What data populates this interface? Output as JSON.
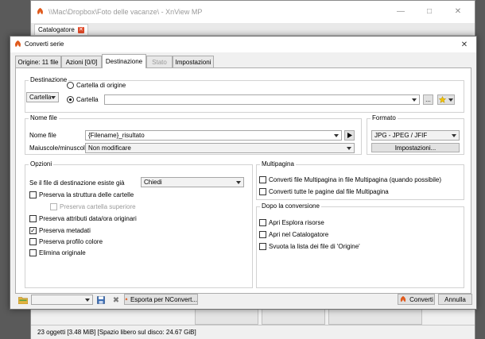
{
  "background_window": {
    "title": "\\\\Mac\\Dropbox\\Foto delle vacanze\\ - XnView MP",
    "tab_label": "Catalogatore",
    "status_text": "23 oggetti [3.48 MiB] [Spazio libero sul disco: 24.67 GiB]"
  },
  "dialog": {
    "title": "Converti serie",
    "tabs": [
      {
        "label": "Origine: 11 file"
      },
      {
        "label": "Azioni [0/0]"
      },
      {
        "label": "Destinazione"
      },
      {
        "label": "Stato"
      },
      {
        "label": "Impostazioni"
      }
    ],
    "destinazione": {
      "group_label": "Destinazione",
      "mode_select_value": "Cartella",
      "radio_origin_label": "Cartella di origine",
      "radio_folder_label": "Cartella",
      "folder_path_value": "",
      "browse_label": "..."
    },
    "nome_file": {
      "group_label": "Nome file",
      "name_label": "Nome file",
      "name_value": "{Filename}_risultato",
      "case_label": "Maiuscole/minuscole",
      "case_value": "Non modificare"
    },
    "formato": {
      "group_label": "Formato",
      "format_value": "JPG - JPEG / JFIF",
      "settings_button": "Impostazioni..."
    },
    "opzioni": {
      "group_label": "Opzioni",
      "exists_label": "Se il file di destinazione esiste già",
      "exists_value": "Chiedi",
      "items": [
        {
          "label": "Preserva la struttura delle cartelle",
          "checked": false,
          "disabled": false
        },
        {
          "label": "Preserva cartella superiore",
          "checked": false,
          "disabled": true
        },
        {
          "label": "Preserva attributi data/ora originari",
          "checked": false,
          "disabled": false
        },
        {
          "label": "Preserva metadati",
          "checked": true,
          "disabled": false
        },
        {
          "label": "Preserva profilo colore",
          "checked": false,
          "disabled": false
        },
        {
          "label": "Elimina originale",
          "checked": false,
          "disabled": false
        }
      ]
    },
    "multipagina": {
      "group_label": "Multipagina",
      "items": [
        {
          "label": "Converti file Multipagina in file Multipagina (quando possibile)",
          "checked": false
        },
        {
          "label": "Converti tutte le pagine dal file Multipagina",
          "checked": false
        }
      ]
    },
    "dopo": {
      "group_label": "Dopo la conversione",
      "items": [
        {
          "label": "Apri Esplora risorse",
          "checked": false
        },
        {
          "label": "Apri nel Catalogatore",
          "checked": false
        },
        {
          "label": "Svuota la lista dei file di 'Origine'",
          "checked": false
        }
      ]
    },
    "footer": {
      "preset_value": "",
      "export_button": "Esporta per NConvert...",
      "convert_button": "Converti",
      "cancel_button": "Annulla"
    }
  },
  "colors": {
    "accent_icon": "#e05a1c",
    "folder_icon": "#e3b341",
    "star_icon": "#f2c200",
    "close_red": "#e24b2a"
  }
}
